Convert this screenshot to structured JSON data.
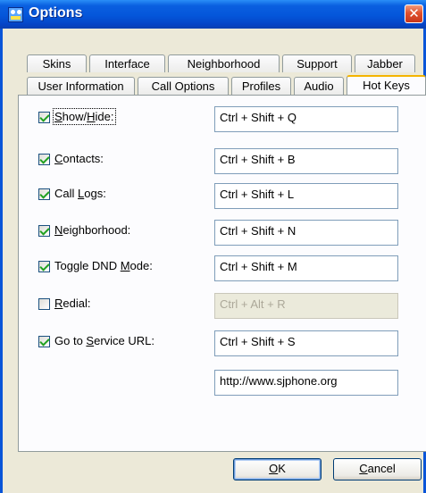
{
  "window": {
    "title": "Options",
    "close_glyph": "✕"
  },
  "tabs": {
    "row_back": [
      "Skins",
      "Interface",
      "Neighborhood",
      "Support",
      "Jabber"
    ],
    "row_front": [
      "User Information",
      "Call Options",
      "Profiles",
      "Audio",
      "Hot Keys"
    ],
    "active": "Hot Keys"
  },
  "hotkeys": [
    {
      "label_parts": [
        "",
        "S",
        "how/",
        "H",
        "ide:"
      ],
      "checked": true,
      "value": "Ctrl + Shift + Q",
      "enabled": true
    },
    {
      "label_parts": [
        "",
        "C",
        "ontacts:"
      ],
      "checked": true,
      "value": "Ctrl + Shift + B",
      "enabled": true
    },
    {
      "label_parts": [
        "Call ",
        "L",
        "ogs:"
      ],
      "checked": true,
      "value": "Ctrl + Shift + L",
      "enabled": true
    },
    {
      "label_parts": [
        "",
        "N",
        "eighborhood:"
      ],
      "checked": true,
      "value": "Ctrl + Shift + N",
      "enabled": true
    },
    {
      "label_parts": [
        "Toggle DND ",
        "M",
        "ode:"
      ],
      "checked": true,
      "value": "Ctrl + Shift + M",
      "enabled": true
    },
    {
      "label_parts": [
        "",
        "R",
        "edial:"
      ],
      "checked": false,
      "value": "Ctrl + Alt + R",
      "enabled": false
    },
    {
      "label_parts": [
        "Go to ",
        "S",
        "ervice URL:"
      ],
      "checked": true,
      "value": "Ctrl + Shift + S",
      "enabled": true
    }
  ],
  "service_url": "http://www.sjphone.org",
  "buttons": {
    "ok": {
      "prefix": "",
      "accel": "O",
      "suffix": "K"
    },
    "cancel": {
      "prefix": "",
      "accel": "C",
      "suffix": "ancel"
    }
  },
  "colors": {
    "title_bar": "#0456da",
    "dialog_bg": "#ece9d8",
    "active_tab_accent": "#f4b400",
    "check_mark": "#21a121"
  }
}
